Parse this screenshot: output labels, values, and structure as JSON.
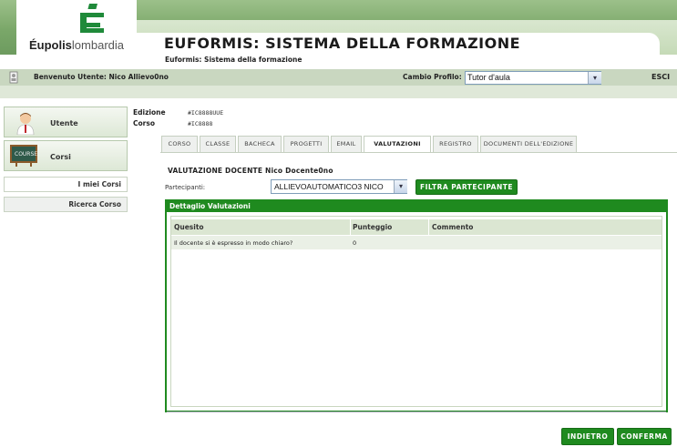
{
  "header": {
    "logo_text_bold": "Éupolis",
    "logo_text_light": "lombardia",
    "app_title": "EUFORMIS: SISTEMA DELLA FORMAZIONE",
    "app_subtitle": "Euformis: Sistema della formazione"
  },
  "userbar": {
    "welcome": "Benvenuto Utente: Nico Allievo0no",
    "profile_label": "Cambio Profilo:",
    "profile_value": "Tutor d'aula",
    "logout": "ESCI"
  },
  "sidebar": {
    "user_label": "Utente",
    "courses_label": "Corsi",
    "links": [
      "I miei Corsi",
      "Ricerca Corso"
    ]
  },
  "meta": {
    "edition_label": "Edizione",
    "edition_value": "#IC8888UUE",
    "course_label": "Corso",
    "course_value": "#IC8888"
  },
  "tabs": [
    "CORSO",
    "CLASSE",
    "BACHECA",
    "PROGETTI",
    "EMAIL",
    "VALUTAZIONI",
    "REGISTRO",
    "DOCUMENTI DELL'EDIZIONE"
  ],
  "active_tab": "VALUTAZIONI",
  "section": {
    "title": "VALUTAZIONE DOCENTE Nico Docente0no",
    "participants_label": "Partecipanti:",
    "participants_value": "ALLIEVOAUTOMATICO3 NICO",
    "filter_button": "FILTRA PARTECIPANTE"
  },
  "details": {
    "title": "Dettaglio Valutazioni",
    "columns": [
      "Quesito",
      "Punteggio",
      "Commento"
    ],
    "rows": [
      [
        "Il docente si è espresso in modo chiaro?",
        "0",
        ""
      ]
    ]
  },
  "footer": {
    "back_button": "INDIETRO",
    "confirm_button": "CONFERMA"
  },
  "colors": {
    "primary_green": "#1f8a1f",
    "header_green": "#7aa769",
    "panel_green": "#dbe6d2"
  }
}
